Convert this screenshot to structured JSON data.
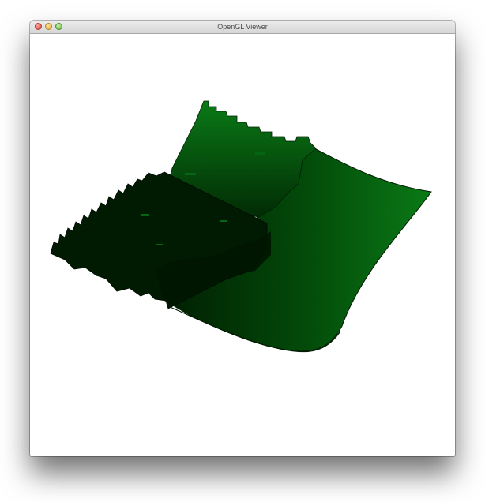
{
  "window": {
    "title": "OpenGL Viewer",
    "controls": [
      "close",
      "minimize",
      "zoom"
    ]
  },
  "viewport": {
    "content": "green-surface-render",
    "colors": {
      "surface_dark": "#011f02",
      "surface_mid": "#034d0a",
      "surface_light": "#0a7a16",
      "background": "#ffffff"
    }
  }
}
